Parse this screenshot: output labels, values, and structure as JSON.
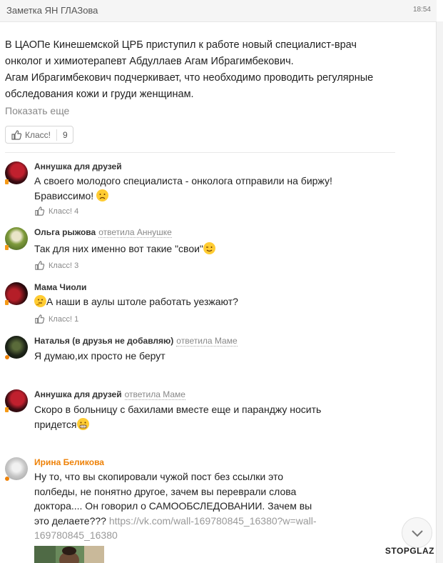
{
  "header": {
    "title": "Заметка ЯН ГЛАЗова",
    "time": "18:54"
  },
  "post": {
    "text": [
      "В ЦАОПе Кинешемской ЦРБ приступил к работе новый специалист-врач онколог и химиотерапевт Абдуллаев Агам Ибрагимбекович.",
      "Агам Ибрагимбекович подчеркивает, что необходимо проводить регулярные обследования кожи и груди женщинам."
    ],
    "show_more": "Показать еще",
    "klass_label": "Класс!",
    "klass_count": "9"
  },
  "comments": [
    {
      "author": "Аннушка для друзей",
      "reply": "",
      "text": "А своего молодого специалиста - онколога отправили на биржу! Брависсимо!",
      "emoji": "disappointed",
      "likes_label": "Класс!",
      "likes_count": "4"
    },
    {
      "author": "Ольга рыжова",
      "reply": "ответила Аннушке",
      "text": "Так для них именно вот такие \"свои\"",
      "emoji": "wink",
      "likes_label": "Класс!",
      "likes_count": "3"
    },
    {
      "author": "Мама Чиоли",
      "reply": "",
      "text": "А наши в аулы штоле работать уезжают?",
      "emoji": "thinking",
      "likes_label": "Класс!",
      "likes_count": "1"
    },
    {
      "author": "Наталья (в друзья не добавляю)",
      "reply": "ответила Маме",
      "text": "Я думаю,их просто не берут",
      "emoji": "",
      "likes_label": "",
      "likes_count": ""
    },
    {
      "author": "Аннушка для друзей",
      "reply": "ответила Маме",
      "text": "Скоро в больницу с бахилами вместе еще и паранджу носить придется",
      "emoji": "grimace",
      "likes_label": "",
      "likes_count": ""
    },
    {
      "author": "Ирина Беликова",
      "reply": "",
      "text": "Ну то, что вы скопировали чужой пост без ссылки это полбеды, не понятно другое, зачем вы переврали слова доктора.... Он говорил о САМООБСЛЕДОВАНИИ. Зачем вы это делаете???",
      "link": "https://vk.com/wall-169780845_16380?w=wall-169780845_16380",
      "emoji": "",
      "likes_label": "",
      "likes_count": ""
    }
  ],
  "watermark": "STOPGLAZ",
  "colors": {
    "accent": "#ee8208",
    "muted": "#888888"
  },
  "icons": {
    "like": "thumbs-up-icon",
    "scroll": "chevron-down-icon",
    "online": "online-indicator"
  }
}
